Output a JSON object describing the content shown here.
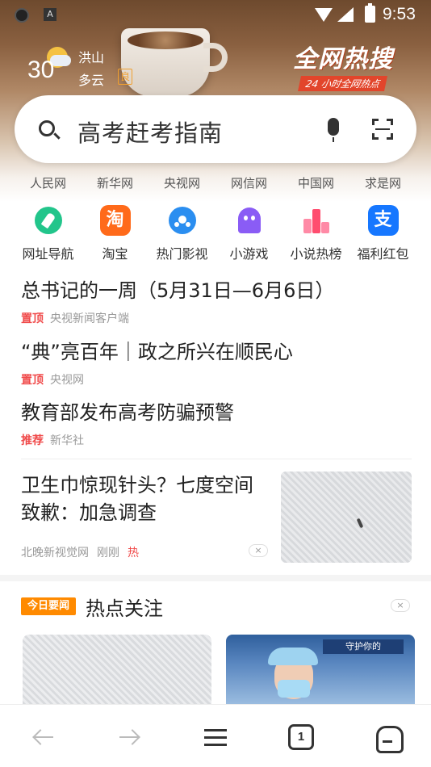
{
  "status_bar": {
    "time": "9:53",
    "left_icon_2": "A"
  },
  "weather": {
    "temperature": "30",
    "city": "洪山",
    "condition": "多云",
    "aqi": "良"
  },
  "brand": {
    "title": "全网热搜",
    "subtitle": "24 小时全网热点"
  },
  "search": {
    "query": "高考赶考指南"
  },
  "quick_links": [
    "人民网",
    "新华网",
    "央视网",
    "网信网",
    "中国网",
    "求是网"
  ],
  "apps": [
    {
      "label": "网址导航",
      "icon": "compass-icon"
    },
    {
      "label": "淘宝",
      "icon": "taobao-icon",
      "glyph": "淘"
    },
    {
      "label": "热门影视",
      "icon": "film-reel-icon"
    },
    {
      "label": "小游戏",
      "icon": "ghost-game-icon"
    },
    {
      "label": "小说热榜",
      "icon": "ranking-icon"
    },
    {
      "label": "福利红包",
      "icon": "alipay-icon",
      "glyph": "支"
    }
  ],
  "news": [
    {
      "title": "总书记的一周（5月31日—6月6日）",
      "tag": "置顶",
      "source": "央视新闻客户端"
    },
    {
      "title": "“典”亮百年｜政之所兴在顺民心",
      "tag": "置顶",
      "source": "央视网"
    },
    {
      "title": "教育部发布高考防骗预警",
      "tag": "推荐",
      "source": "新华社"
    }
  ],
  "image_news": {
    "title": "卫生巾惊现针头？七度空间致歉：加急调查",
    "source": "北晚新视觉网",
    "time": "刚刚",
    "hot": "热",
    "close": "×"
  },
  "hot_section": {
    "badge": "今日要闻",
    "title": "热点关注",
    "close": "×"
  },
  "card2": {
    "banner": "守护你的"
  },
  "bottom_nav": {
    "tabs_count": "1"
  },
  "colors": {
    "accent_red": "#f04a4a",
    "badge_orange": "#ff8a00",
    "taobao_orange": "#ff6a1a",
    "alipay_blue": "#1677ff"
  }
}
